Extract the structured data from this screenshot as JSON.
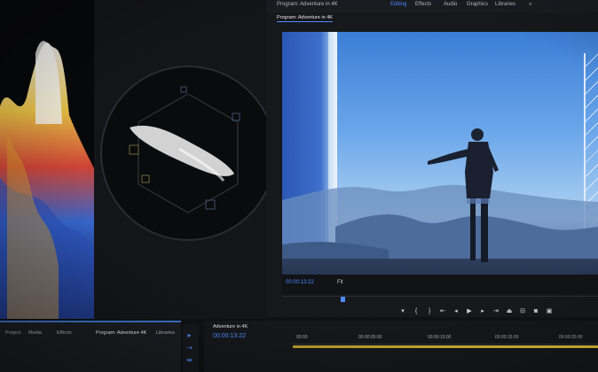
{
  "menu": {
    "sequence_title": "Program: Adventure in 4K",
    "tabs": [
      "Editing",
      "Effects",
      "Audio",
      "Graphics",
      "Libraries"
    ],
    "more": "»"
  },
  "program_monitor": {
    "tab_label": "Program: Adventure in 4K",
    "timecode": "00:00:13:22",
    "fit": "Fit",
    "controls": [
      "add-marker",
      "mark-in",
      "mark-out",
      "go-to-in",
      "step-back",
      "play",
      "step-forward",
      "go-to-out",
      "lift",
      "extract",
      "export-frame",
      "compare"
    ]
  },
  "project_panel": {
    "tabs": [
      "Project",
      "Media",
      "Effects",
      "Program: Adventure 4K",
      "Libraries"
    ],
    "active_tab_index": 3,
    "more": "≡"
  },
  "timeline": {
    "tab_label": "Adventure in 4K",
    "timecode": "00:00:13:22",
    "ruler": [
      "00:00",
      "00:00:05:00",
      "00:00:10:00",
      "00:00:15:00",
      "00:00:20:00"
    ]
  },
  "colors": {
    "accent": "#4c8cff",
    "work_area": "#e2c23a"
  }
}
